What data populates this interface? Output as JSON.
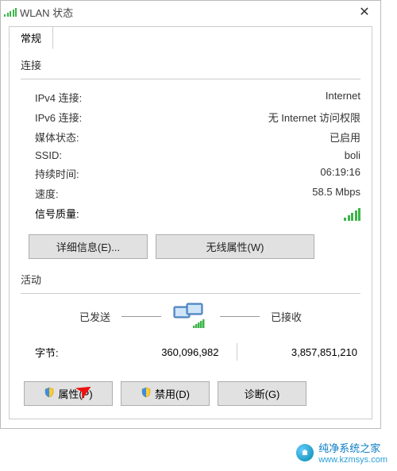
{
  "window": {
    "title": "WLAN 状态",
    "close": "✕"
  },
  "tabs": {
    "general": "常规"
  },
  "connection": {
    "heading": "连接",
    "ipv4_label": "IPv4 连接:",
    "ipv4_value": "Internet",
    "ipv6_label": "IPv6 连接:",
    "ipv6_value": "无 Internet 访问权限",
    "media_label": "媒体状态:",
    "media_value": "已启用",
    "ssid_label": "SSID:",
    "ssid_value": "boli",
    "duration_label": "持续时间:",
    "duration_value": "06:19:16",
    "speed_label": "速度:",
    "speed_value": "58.5 Mbps",
    "signal_label": "信号质量:"
  },
  "buttons": {
    "details": "详细信息(E)...",
    "wireless_props": "无线属性(W)",
    "properties": "属性(P)",
    "disable": "禁用(D)",
    "diagnose": "诊断(G)"
  },
  "activity": {
    "heading": "活动",
    "sent_label": "已发送",
    "recv_label": "已接收",
    "bytes_label": "字节:",
    "bytes_sent": "360,096,982",
    "bytes_recv": "3,857,851,210"
  },
  "watermark": {
    "name": "纯净系统之家",
    "url": "www.kzmsys.com"
  }
}
